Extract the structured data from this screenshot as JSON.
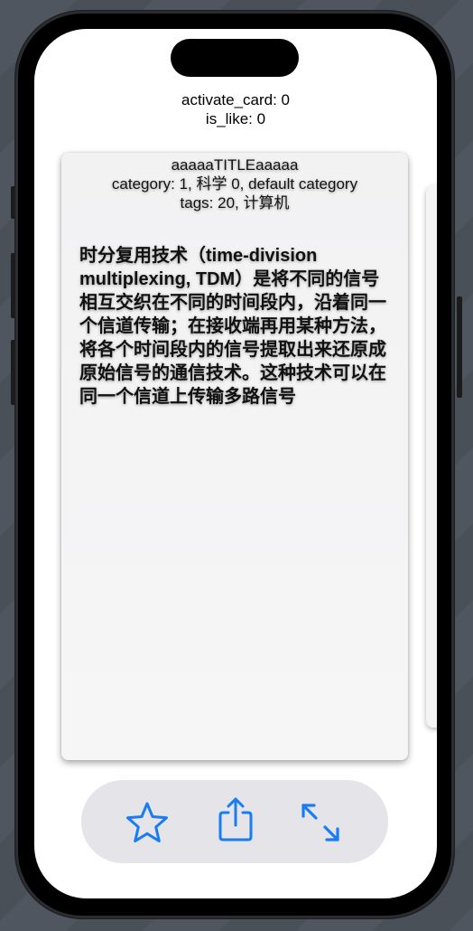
{
  "debug": {
    "activate_card": "activate_card: 0",
    "is_like": "is_like: 0"
  },
  "card": {
    "title": "aaaaaTITLEaaaaa",
    "category": "category:  1, 科学  0, default category",
    "tags": "tags:   20, 计算机",
    "body": "时分复用技术（time-division multiplexing, TDM）是将不同的信号相互交织在不同的时间段内，沿着同一个信道传输；在接收端再用某种方法，将各个时间段内的信号提取出来还原成原始信号的通信技术。这种技术可以在同一个信道上传输多路信号"
  },
  "toolbar": {
    "buttons": [
      {
        "icon": "star-icon",
        "action": "like"
      },
      {
        "icon": "share-icon",
        "action": "share"
      },
      {
        "icon": "expand-icon",
        "action": "expand"
      }
    ],
    "accent_color": "#1a7cf5",
    "background_color": "#e4e4e9"
  }
}
